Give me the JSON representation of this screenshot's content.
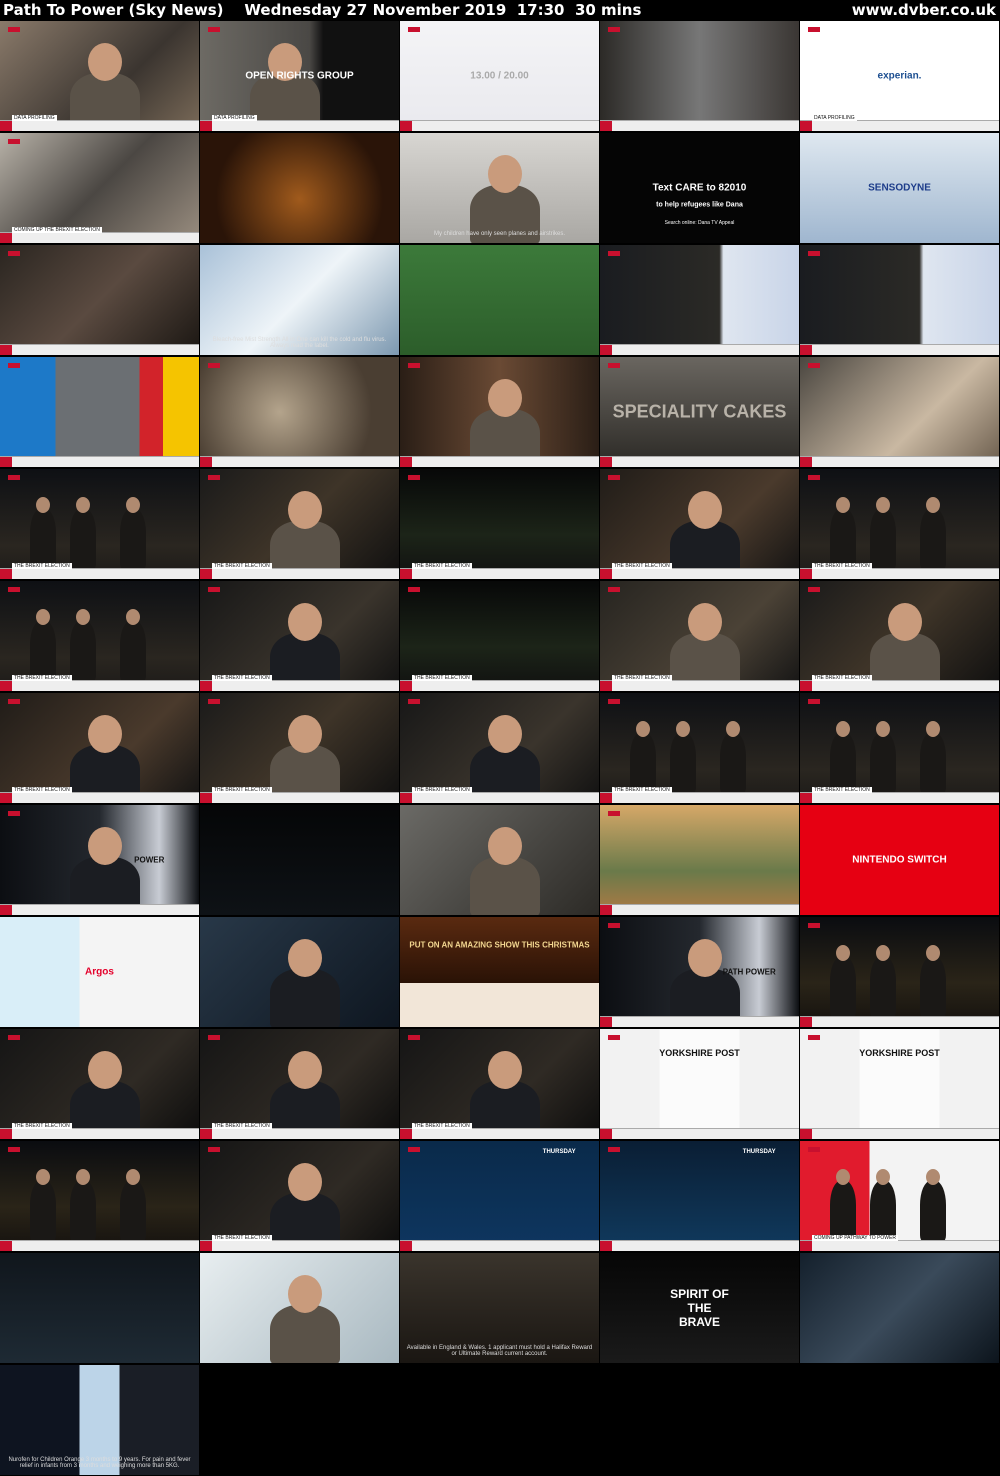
{
  "header": {
    "title": "Path To Power (Sky News)    Wednesday 27 November 2019  17:30  30 mins",
    "site": "www.dvber.co.uk"
  },
  "colors": {
    "background": "#000000",
    "sky_red": "#c8102e"
  },
  "thumbnails": [
    {
      "scene": "interview-sofa",
      "caption": "DATA PROFILING"
    },
    {
      "scene": "interview-open-rights",
      "caption": "DATA PROFILING",
      "overlay": "OPEN RIGHTS GROUP"
    },
    {
      "scene": "screen-numbers",
      "overlay": "13.00 / 20.00"
    },
    {
      "scene": "doorway"
    },
    {
      "scene": "experian-graphic",
      "overlay": "experian.",
      "caption": "DATA PROFILING"
    },
    {
      "scene": "cafe",
      "caption": "COMING UP  THE BREXIT ELECTION"
    },
    {
      "scene": "ad-dinner"
    },
    {
      "scene": "ad-refugee",
      "subtitle": "My children have only seen planes and airstrikes."
    },
    {
      "scene": "ad-care",
      "overlay": "Text CARE to 82010",
      "overlay2": "to help refugees like Dana",
      "overlay3": "Search online: Dana TV Appeal"
    },
    {
      "scene": "ad-sensodyne",
      "overlay": "SENSODYNE"
    },
    {
      "scene": "bowling"
    },
    {
      "scene": "ad-bleach",
      "subtitle": "Bleach-free Mist Strength All in One can kill the cold and flu virus. Always read the label."
    },
    {
      "scene": "football"
    },
    {
      "scene": "results-board"
    },
    {
      "scene": "results-board"
    },
    {
      "scene": "colour-bars"
    },
    {
      "scene": "blur-party"
    },
    {
      "scene": "waiter"
    },
    {
      "scene": "speciality-cakes",
      "overlay": "SPECIALITY CAKES"
    },
    {
      "scene": "cupcakes"
    },
    {
      "scene": "night-group",
      "caption": "THE BREXIT ELECTION"
    },
    {
      "scene": "umbrella-woman",
      "caption": "THE BREXIT ELECTION"
    },
    {
      "scene": "night-gazebo",
      "caption": "THE BREXIT ELECTION"
    },
    {
      "scene": "bearded-man",
      "caption": "THE BREXIT ELECTION"
    },
    {
      "scene": "night-group",
      "caption": "THE BREXIT ELECTION"
    },
    {
      "scene": "night-group",
      "caption": "THE BREXIT ELECTION"
    },
    {
      "scene": "older-man",
      "caption": "THE BREXIT ELECTION"
    },
    {
      "scene": "night-gazebo",
      "caption": "THE BREXIT ELECTION"
    },
    {
      "scene": "older-man-umbrella",
      "caption": "THE BREXIT ELECTION"
    },
    {
      "scene": "umbrella-woman",
      "caption": "THE BREXIT ELECTION"
    },
    {
      "scene": "bearded-man",
      "caption": "THE BREXIT ELECTION"
    },
    {
      "scene": "umbrella-woman",
      "caption": "THE BREXIT ELECTION"
    },
    {
      "scene": "older-man",
      "caption": "THE BREXIT ELECTION"
    },
    {
      "scene": "night-group",
      "caption": "THE BREXIT ELECTION"
    },
    {
      "scene": "night-group",
      "caption": "THE BREXIT ELECTION"
    },
    {
      "scene": "bus-presenter",
      "overlay": "POWER"
    },
    {
      "scene": "dark"
    },
    {
      "scene": "car-man"
    },
    {
      "scene": "theme-park"
    },
    {
      "scene": "nintendo",
      "overlay": "NINTENDO SWITCH"
    },
    {
      "scene": "argos-switch",
      "overlay": "Argos"
    },
    {
      "scene": "smiling-man"
    },
    {
      "scene": "aldi-christmas",
      "overlay": "PUT ON AN AMAZING SHOW THIS CHRISTMAS"
    },
    {
      "scene": "bus-presenter",
      "overlay": "PATH POWER"
    },
    {
      "scene": "night-pair"
    },
    {
      "scene": "presenter-dark",
      "caption": "THE BREXIT ELECTION"
    },
    {
      "scene": "presenter-dark",
      "caption": "THE BREXIT ELECTION"
    },
    {
      "scene": "presenter-dark",
      "caption": "THE BREXIT ELECTION"
    },
    {
      "scene": "newspaper",
      "overlay": "YORKSHIRE POST"
    },
    {
      "scene": "newspaper",
      "overlay": "YORKSHIRE POST"
    },
    {
      "scene": "night-pair"
    },
    {
      "scene": "presenter-dark",
      "caption": "THE BREXIT ELECTION"
    },
    {
      "scene": "weather-map",
      "overlay": "THURSDAY"
    },
    {
      "scene": "weather-map2",
      "overlay": "THURSDAY"
    },
    {
      "scene": "labour-stage",
      "caption": "COMING UP  PATHWAY TO POWER"
    },
    {
      "scene": "dark-room"
    },
    {
      "scene": "dentist"
    },
    {
      "scene": "ad-lights",
      "subtitle": "Available in England & Wales. 1 applicant must hold a Halifax Reward or Ultimate Reward current account."
    },
    {
      "scene": "ad-diesel",
      "overlay": "SPIRIT OF THE BRAVE"
    },
    {
      "scene": "delivery"
    },
    {
      "scene": "ad-nurofen",
      "subtitle": "Nurofen for Children Orange 3 months to 9 years. For pain and fever relief in infants from 3 months and weighing more than 5KG."
    }
  ]
}
